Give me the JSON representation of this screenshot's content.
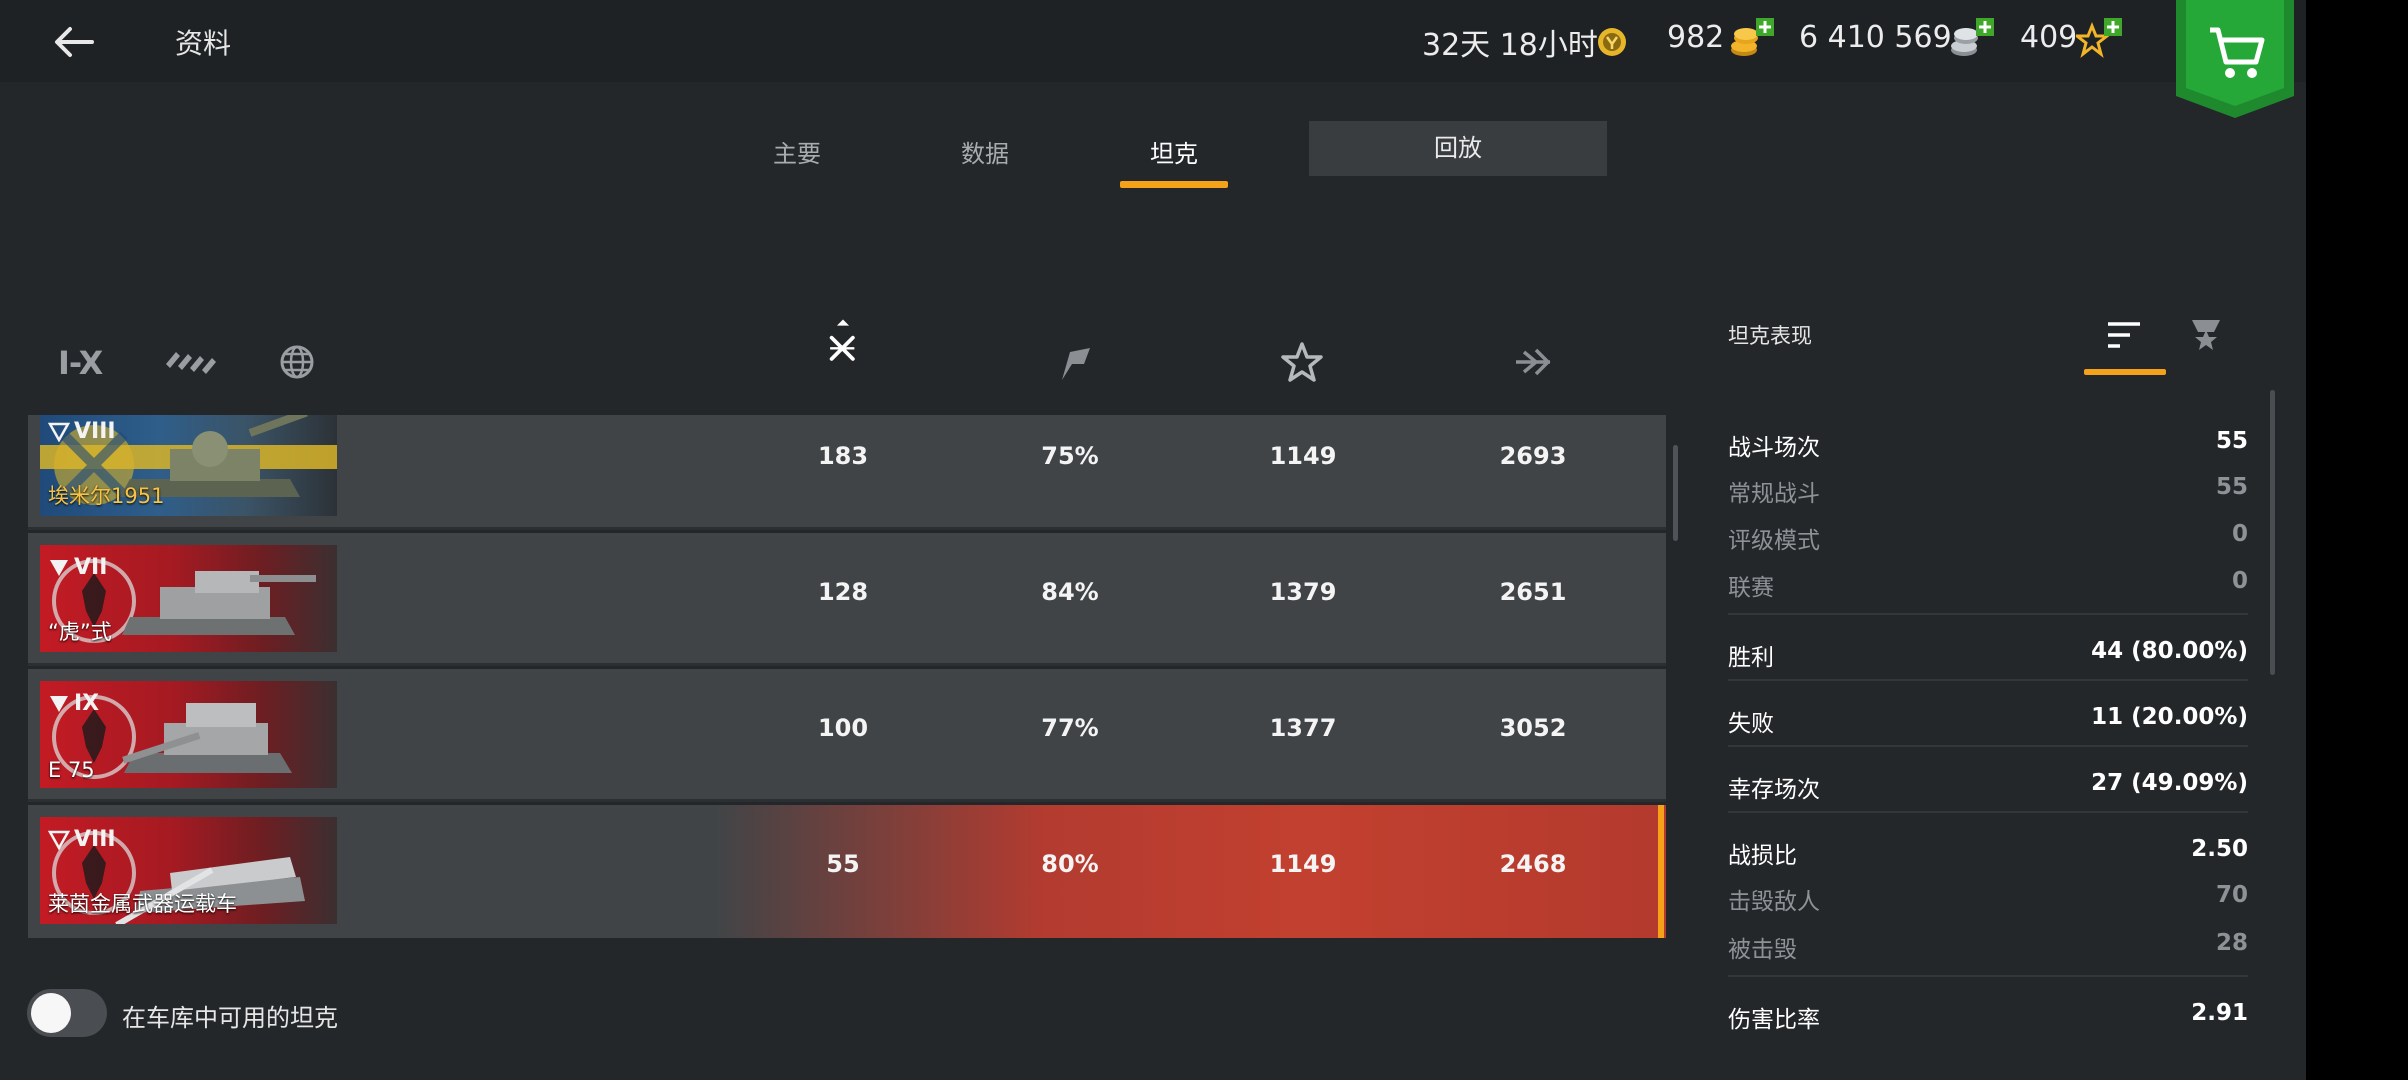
{
  "header": {
    "title": "资料",
    "timer": "32天 18小时",
    "gold": "982",
    "credits": "6 410 569",
    "free_xp": "409"
  },
  "tabs": [
    {
      "label": "主要"
    },
    {
      "label": "数据"
    },
    {
      "label": "坦克",
      "active": true
    }
  ],
  "replay_label": "回放",
  "filters": {
    "tier_label": "I-X"
  },
  "tanks": [
    {
      "tier": "VIII",
      "name": "埃米尔1951",
      "nation": "sweden",
      "premium": true,
      "battles": "183",
      "winrate": "75%",
      "avg_xp": "1149",
      "avg_damage": "2693"
    },
    {
      "tier": "VII",
      "name": "“虎”式",
      "nation": "germany",
      "premium": false,
      "battles": "128",
      "winrate": "84%",
      "avg_xp": "1379",
      "avg_damage": "2651"
    },
    {
      "tier": "IX",
      "name": "E 75",
      "nation": "germany",
      "premium": false,
      "battles": "100",
      "winrate": "77%",
      "avg_xp": "1377",
      "avg_damage": "3052"
    },
    {
      "tier": "VIII",
      "name": "莱茵金属武器运载车",
      "nation": "germany",
      "premium": false,
      "selected": true,
      "battles": "55",
      "winrate": "80%",
      "avg_xp": "1149",
      "avg_damage": "2468"
    }
  ],
  "toggle_label": "在车库中可用的坦克",
  "performance": {
    "title": "坦克表现",
    "stats": [
      {
        "label": "战斗场次",
        "value": "55",
        "type": "main"
      },
      {
        "label": "常规战斗",
        "value": "55",
        "type": "sub"
      },
      {
        "label": "评级模式",
        "value": "0",
        "type": "sub"
      },
      {
        "label": "联赛",
        "value": "0",
        "type": "sub"
      },
      {
        "label": "胜利",
        "value": "44 (80.00%)",
        "type": "main"
      },
      {
        "label": "失败",
        "value": "11 (20.00%)",
        "type": "main"
      },
      {
        "label": "幸存场次",
        "value": "27 (49.09%)",
        "type": "main"
      },
      {
        "label": "战损比",
        "value": "2.50",
        "type": "main"
      },
      {
        "label": "击毁敌人",
        "value": "70",
        "type": "sub"
      },
      {
        "label": "被击毁",
        "value": "28",
        "type": "sub"
      },
      {
        "label": "伤害比率",
        "value": "2.91",
        "type": "main"
      }
    ]
  },
  "colors": {
    "accent": "#f4a21a",
    "selected_row": "#c2402f",
    "background": "#24272a"
  }
}
